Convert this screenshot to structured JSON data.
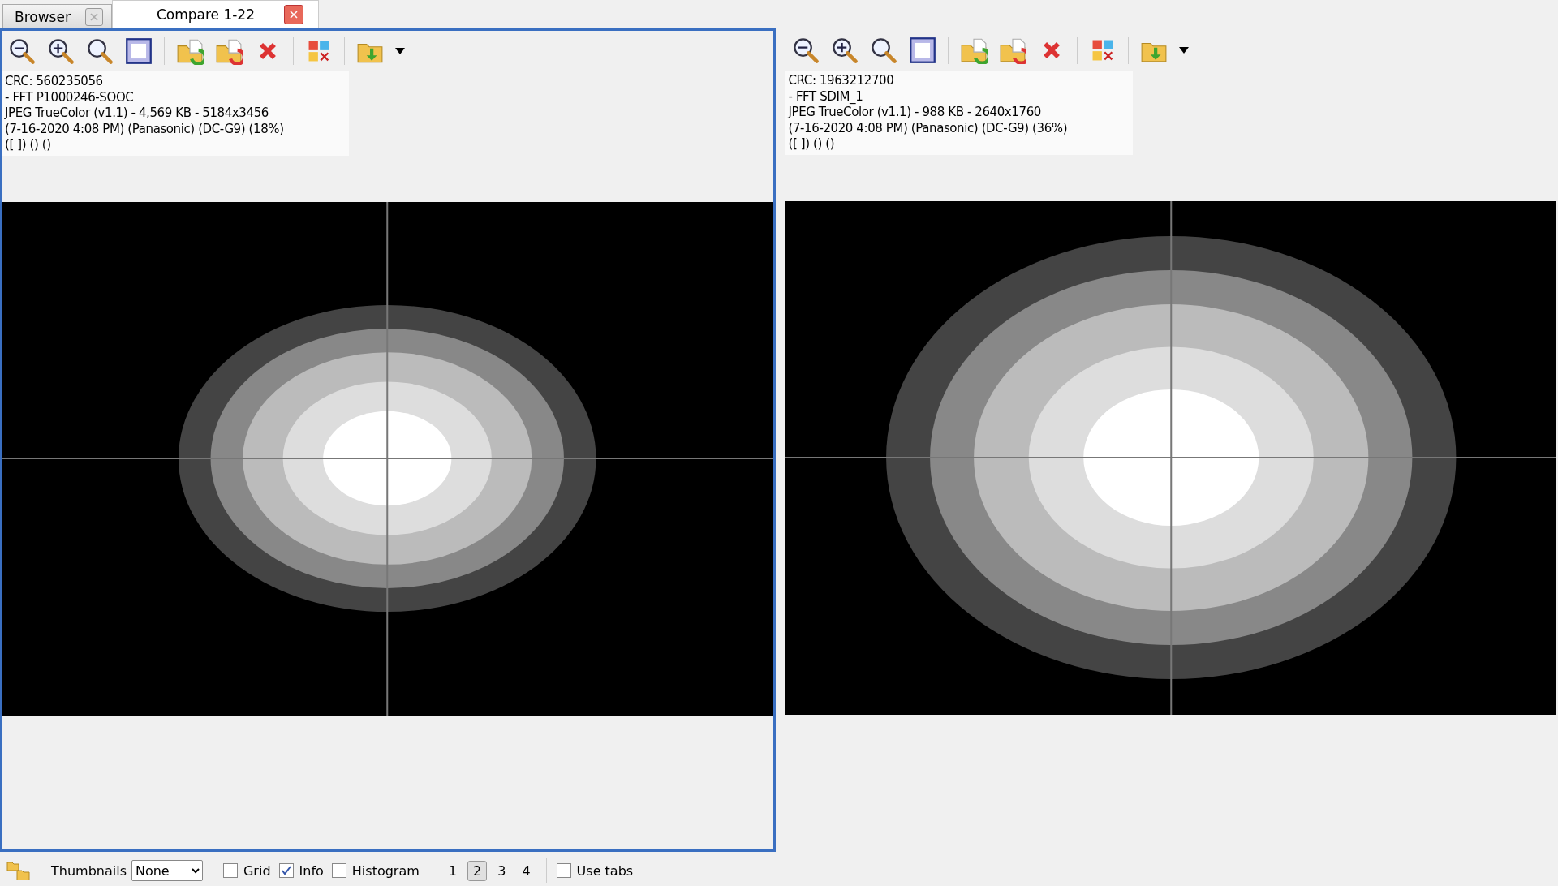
{
  "tabs": [
    {
      "label": "Browser",
      "selected": false
    },
    {
      "label": "Compare 1-22",
      "selected": true
    }
  ],
  "panes": [
    {
      "selected": true,
      "info": [
        "CRC: 560235056",
        "- FFT P1000246-SOOC",
        "JPEG TrueColor (v1.1) - 4,569 KB - 5184x3456",
        "(7-16-2020 4:08 PM) (Panasonic) (DC-G9) (18%)",
        "([ ]) () ()"
      ]
    },
    {
      "selected": false,
      "info": [
        "CRC: 1963212700",
        "- FFT SDIM_1",
        "JPEG TrueColor (v1.1) - 988 KB - 2640x1760",
        "(7-16-2020 4:08 PM) (Panasonic) (DC-G9) (36%)",
        "([ ]) () ()"
      ]
    }
  ],
  "bottom_bar": {
    "thumbnails": {
      "label": "Thumbnails",
      "value": "None"
    },
    "checkboxes": [
      {
        "label": "Grid",
        "checked": false
      },
      {
        "label": "Info",
        "checked": true
      },
      {
        "label": "Histogram",
        "checked": false
      }
    ],
    "pages": [
      {
        "label": "1",
        "selected": false
      },
      {
        "label": "2",
        "selected": true
      },
      {
        "label": "3",
        "selected": false
      },
      {
        "label": "4",
        "selected": false
      }
    ],
    "use_tabs": {
      "label": "Use tabs",
      "checked": false
    }
  }
}
